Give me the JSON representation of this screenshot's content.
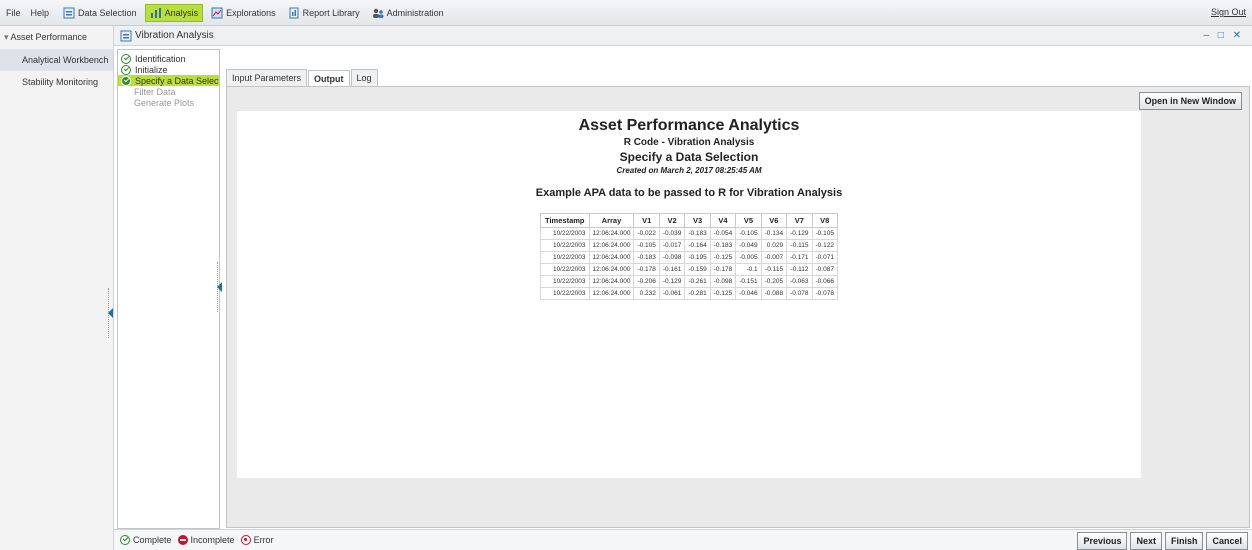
{
  "topbar": {
    "menu": [
      "File",
      "Help"
    ],
    "nav": [
      {
        "label": "Data Selection",
        "icon": "data-selection-icon",
        "active": false
      },
      {
        "label": "Analysis",
        "icon": "analysis-icon",
        "active": true
      },
      {
        "label": "Explorations",
        "icon": "explorations-icon",
        "active": false
      },
      {
        "label": "Report Library",
        "icon": "report-library-icon",
        "active": false
      },
      {
        "label": "Administration",
        "icon": "administration-icon",
        "active": false
      }
    ],
    "sign_out": "Sign Out"
  },
  "sidebar": {
    "root": "Asset Performance",
    "items": [
      {
        "label": "Analytical Workbench",
        "selected": true
      },
      {
        "label": "Stability Monitoring",
        "selected": false
      }
    ]
  },
  "window": {
    "title": "Vibration Analysis",
    "controls": "– □ ✕"
  },
  "steps": [
    {
      "label": "Identification",
      "state": "complete"
    },
    {
      "label": "Initialize",
      "state": "complete"
    },
    {
      "label": "Specify a Data Selectio",
      "state": "current"
    },
    {
      "label": "Filter Data",
      "state": "disabled"
    },
    {
      "label": "Generate Plots",
      "state": "disabled"
    }
  ],
  "tabs": [
    {
      "label": "Input Parameters",
      "active": false
    },
    {
      "label": "Output",
      "active": true
    },
    {
      "label": "Log",
      "active": false
    }
  ],
  "open_button": "Open in New Window",
  "report": {
    "title": "Asset Performance Analytics",
    "subtitle": "R Code - Vibration Analysis",
    "section": "Specify a Data Selection",
    "created": "Created on March 2, 2017 08:25:45 AM",
    "table_title": "Example APA data to be passed to R for Vibration Analysis",
    "columns": [
      "Timestamp",
      "Array",
      "V1",
      "V2",
      "V3",
      "V4",
      "V5",
      "V6",
      "V7",
      "V8"
    ],
    "rows": [
      [
        "10/22/2003",
        "12:06:24.000",
        "-0.022",
        "-0.039",
        "-0.183",
        "-0.054",
        "-0.105",
        "-0.134",
        "-0.129",
        "-0.105"
      ],
      [
        "10/22/2003",
        "12:06:24.000",
        "-0.105",
        "-0.017",
        "-0.164",
        "-0.183",
        "-0.049",
        "0.029",
        "-0.115",
        "-0.122"
      ],
      [
        "10/22/2003",
        "12:06:24.000",
        "-0.183",
        "-0.098",
        "-0.195",
        "-0.125",
        "-0.005",
        "-0.007",
        "-0.171",
        "-0.071"
      ],
      [
        "10/22/2003",
        "12:06:24.000",
        "-0.178",
        "-0.161",
        "-0.159",
        "-0.178",
        "-0.1",
        "-0.115",
        "-0.112",
        "-0.087"
      ],
      [
        "10/22/2003",
        "12:06:24.000",
        "-0.206",
        "-0.129",
        "-0.261",
        "-0.098",
        "-0.151",
        "-0.205",
        "-0.063",
        "-0.066"
      ],
      [
        "10/22/2003",
        "12:06:24.000",
        "0.232",
        "-0.061",
        "-0.281",
        "-0.125",
        "-0.046",
        "-0.088",
        "-0.078",
        "-0.078"
      ]
    ]
  },
  "legend": {
    "complete": "Complete",
    "incomplete": "Incomplete",
    "error": "Error"
  },
  "footer_buttons": [
    "Previous",
    "Next",
    "Finish",
    "Cancel"
  ],
  "colors": {
    "accent": "#b9df3a",
    "link": "#1f6fb2",
    "complete": "#2e8b2e",
    "error": "#c8102e"
  }
}
